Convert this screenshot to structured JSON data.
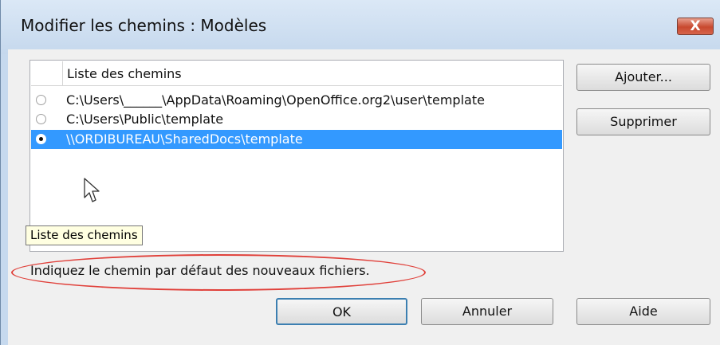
{
  "window": {
    "title": "Modifier les chemins : Modèles",
    "close_label": "X"
  },
  "list": {
    "header": "Liste des chemins",
    "items": [
      {
        "path": "C:\\Users\\______\\AppData\\Roaming\\OpenOffice.org2\\user\\template",
        "selected": false
      },
      {
        "path": "C:\\Users\\Public\\template",
        "selected": false
      },
      {
        "path": "\\\\ORDIBUREAU\\SharedDocs\\template",
        "selected": true
      }
    ]
  },
  "tooltip": "Liste des chemins",
  "status_text": "Indiquez le chemin par défaut des nouveaux fichiers.",
  "buttons": {
    "add": "Ajouter...",
    "delete": "Supprimer",
    "ok": "OK",
    "cancel": "Annuler",
    "help": "Aide"
  },
  "colors": {
    "selection": "#3399ff",
    "annotation": "#e0403a",
    "close_button": "#c8492f"
  },
  "icons": {
    "cursor": "arrow-cursor-icon",
    "close": "close-icon"
  }
}
